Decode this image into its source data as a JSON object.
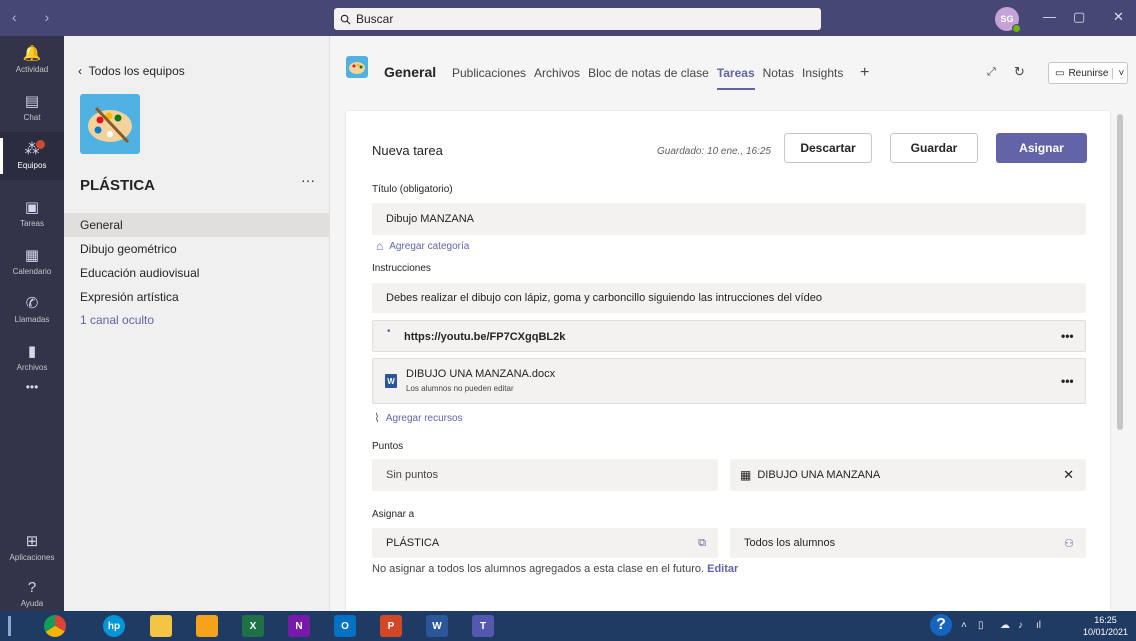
{
  "topbar": {
    "nav_arrows": "‹  ›",
    "search_placeholder": "Buscar",
    "avatar_initials": "SG"
  },
  "rail": [
    {
      "name": "actividad",
      "label": "Actividad",
      "icon": "bell-icon",
      "glyph": "🔔"
    },
    {
      "name": "chat",
      "label": "Chat",
      "icon": "chat-icon",
      "glyph": "▤"
    },
    {
      "name": "equipos",
      "label": "Equipos",
      "icon": "teams-icon",
      "glyph": "⁂"
    },
    {
      "name": "tareas",
      "label": "Tareas",
      "icon": "assignments-icon",
      "glyph": "▣"
    },
    {
      "name": "calendario",
      "label": "Calendario",
      "icon": "calendar-icon",
      "glyph": "▦"
    },
    {
      "name": "llamadas",
      "label": "Llamadas",
      "icon": "phone-icon",
      "glyph": "✆"
    },
    {
      "name": "archivos",
      "label": "Archivos",
      "icon": "files-icon",
      "glyph": "▮"
    }
  ],
  "rail_more": "•••",
  "rail_bottom": {
    "apps_label": "Aplicaciones",
    "help_label": "Ayuda"
  },
  "team": {
    "back_label": "Todos los equipos",
    "name": "PLÁSTICA",
    "more": "···",
    "channels": [
      "General",
      "Dibujo geométrico",
      "Educación audiovisual",
      "Expresión artística"
    ],
    "hidden_channels": "1 canal oculto"
  },
  "header": {
    "channel_title": "General",
    "tabs": [
      "Publicaciones",
      "Archivos",
      "Bloc de notas de clase",
      "Tareas",
      "Notas",
      "Insights"
    ],
    "active_tab": "Tareas",
    "add_tab": "+",
    "reunirse_label": "Reunirse"
  },
  "form": {
    "heading": "Nueva tarea",
    "saved_text": "Guardado: 10 ene., 16:25",
    "discard_label": "Descartar",
    "save_label": "Guardar",
    "assign_label": "Asignar",
    "title_label": "Título (obligatorio)",
    "title_value": "Dibujo MANZANA",
    "add_category": "Agregar categoría",
    "instructions_label": "Instrucciones",
    "instructions_value": "Debes realizar el dibujo con lápiz, goma y carboncillo siguiendo las intrucciones del vídeo",
    "resource_link": "https://youtu.be/FP7CXgqBL2k",
    "resource_doc_name": "DIBUJO UNA MANZANA.docx",
    "resource_doc_note": "Los alumnos no pueden editar",
    "resource_more": "•••",
    "add_resources": "Agregar recursos",
    "points_label": "Puntos",
    "points_value": "Sin puntos",
    "rubric_value": "DIBUJO UNA MANZANA",
    "assign_to_label": "Asignar a",
    "assign_class": "PLÁSTICA",
    "assign_students": "Todos los alumnos",
    "future_note": "No asignar a todos los alumnos agregados a esta clase en el futuro.",
    "edit_link": "Editar"
  },
  "taskbar": {
    "clock_time": "16:25",
    "clock_date": "10/01/2021",
    "apps": [
      {
        "name": "chrome-icon",
        "label": "",
        "color": "#ffffff"
      },
      {
        "name": "hp-icon",
        "label": "hp",
        "color": "#0096d6"
      },
      {
        "name": "file-explorer-icon",
        "label": "",
        "color": "#f4c542"
      },
      {
        "name": "settings-app-icon",
        "label": "",
        "color": "#f7a21b"
      },
      {
        "name": "excel-icon",
        "label": "X",
        "color": "#1e7145"
      },
      {
        "name": "onenote-icon",
        "label": "N",
        "color": "#7719aa"
      },
      {
        "name": "outlook-icon",
        "label": "O",
        "color": "#0072c6"
      },
      {
        "name": "powerpoint-icon",
        "label": "P",
        "color": "#d24726"
      },
      {
        "name": "word-icon",
        "label": "W",
        "color": "#2b579a"
      },
      {
        "name": "teams-taskbar-icon",
        "label": "T",
        "color": "#5558af"
      }
    ]
  },
  "colors": {
    "brand": "#6264a7",
    "topbar": "#464775",
    "rail": "#33344a",
    "taskbar": "#1f3b63"
  }
}
